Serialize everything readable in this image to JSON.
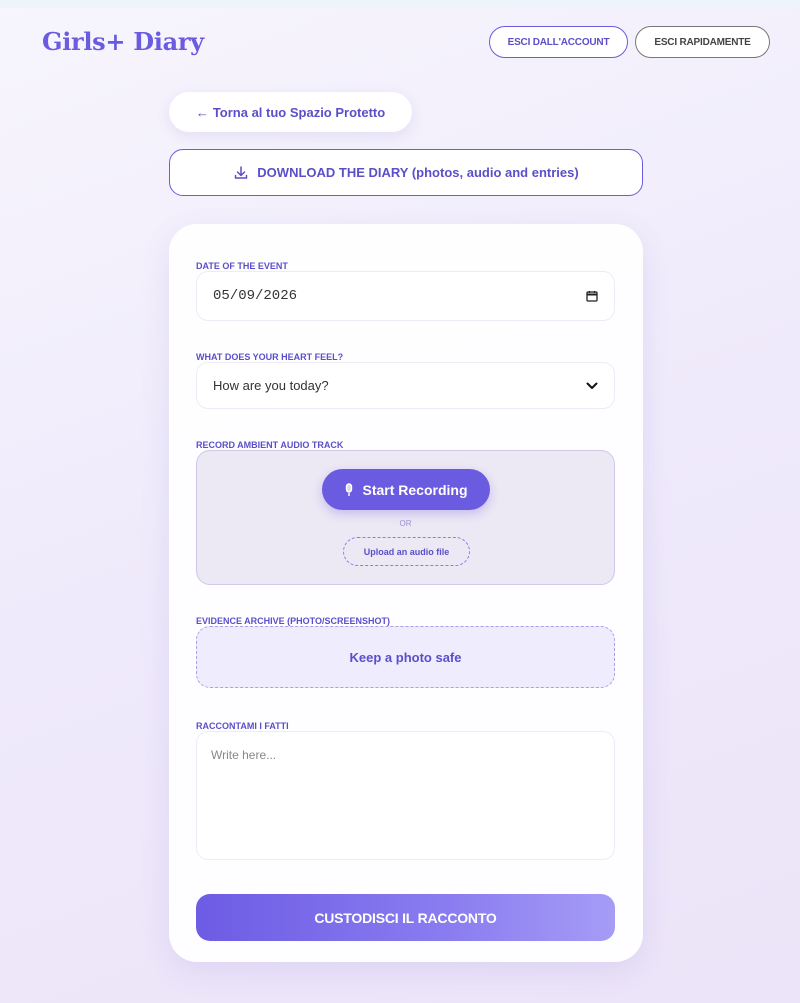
{
  "header": {
    "brand": "Girls+ Diary",
    "logout_label": "ESCI DALL'ACCOUNT",
    "quick_exit_label": "ESCI RAPIDAMENTE"
  },
  "back_button": {
    "arrow": "←",
    "label": "Torna al tuo Spazio Protetto"
  },
  "download_button": {
    "icon": "download-icon",
    "label": "DOWNLOAD THE DIARY (photos, audio and entries)"
  },
  "form": {
    "date": {
      "label": "DATE OF THE EVENT",
      "value": "05/09/2026"
    },
    "mood": {
      "label": "WHAT DOES YOUR HEART FEEL?",
      "selected": "How are you today?"
    },
    "audio": {
      "label": "RECORD AMBIENT AUDIO TRACK",
      "record_label": "Start Recording",
      "or_text": "OR",
      "upload_label": "Upload an audio file"
    },
    "evidence": {
      "label": "EVIDENCE ARCHIVE (PHOTO/SCREENSHOT)",
      "button_label": "Keep a photo safe"
    },
    "story": {
      "label": "RACCONTAMI I FATTI",
      "placeholder": "Write here..."
    },
    "submit_label": "CUSTODISCI IL RACCONTO"
  },
  "colors": {
    "accent": "#6b5be0",
    "background": "#f1ecfb"
  }
}
